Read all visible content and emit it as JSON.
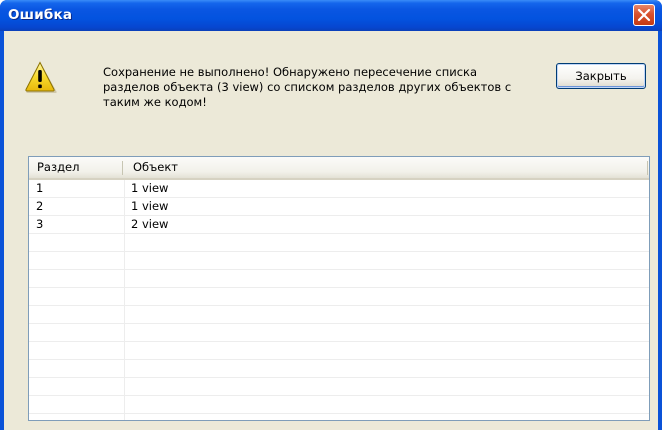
{
  "window": {
    "title": "Ошибка"
  },
  "dialog": {
    "message": "Сохранение не выполнено! Обнаружено пересечение списка разделов объекта (3 view) со списком разделов других объектов с таким же кодом!",
    "close_button_label": "Закрыть"
  },
  "table": {
    "columns": [
      "Раздел",
      "Объект"
    ],
    "rows": [
      {
        "section": "1",
        "object": "1 view"
      },
      {
        "section": "2",
        "object": "1 view"
      },
      {
        "section": "3",
        "object": "2 view"
      }
    ]
  },
  "icons": {
    "title_close": "close-icon",
    "warning": "warning-icon"
  },
  "colors": {
    "titlebar": "#0353DF",
    "close_button": "#D8512E",
    "dialog_background": "#ECE9D8",
    "list_border": "#7F9DB9"
  }
}
